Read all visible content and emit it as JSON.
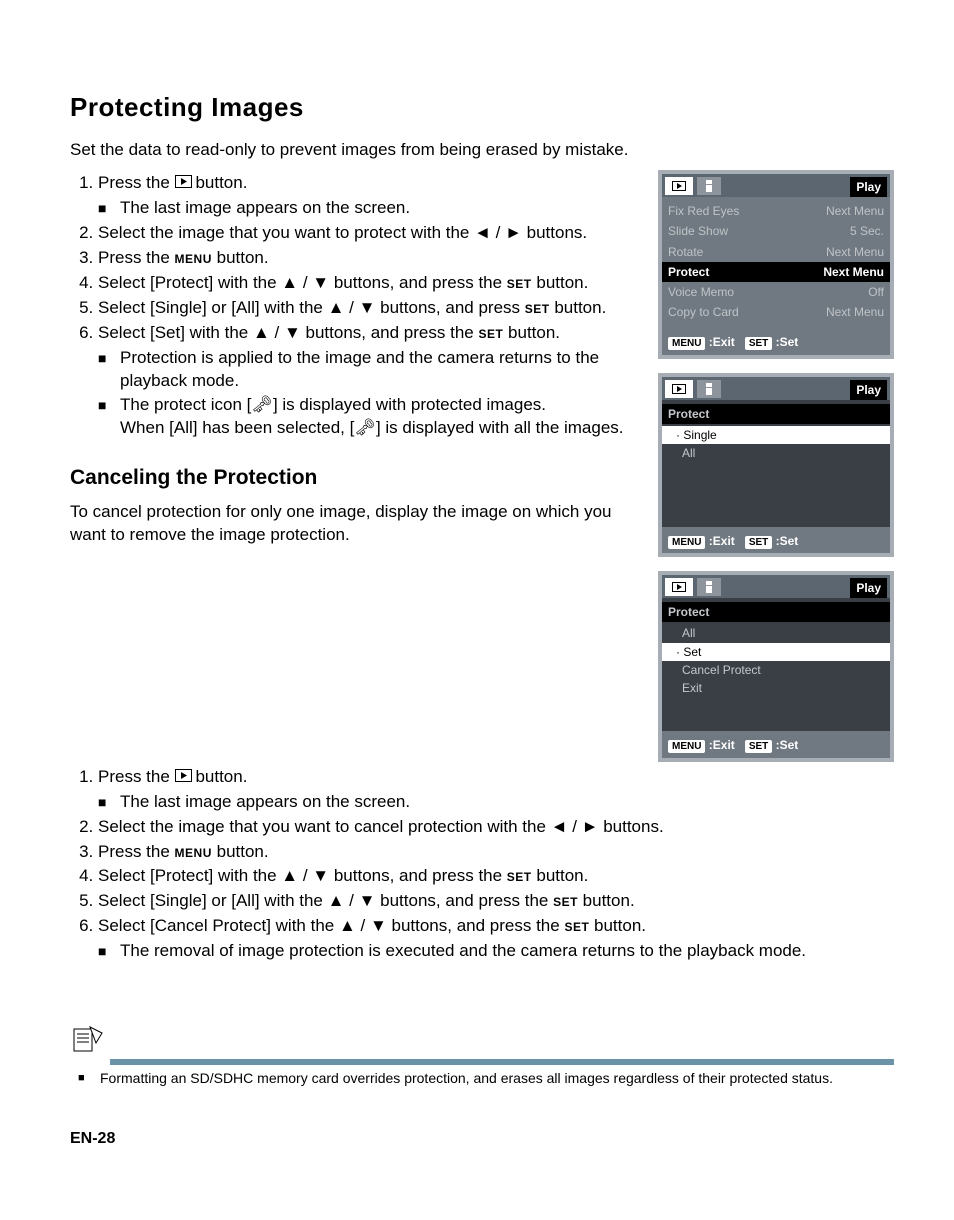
{
  "page_title": "Protecting Images",
  "intro": "Set the data to read-only to prevent images from being erased by mistake.",
  "steps_a": {
    "s1": "Press the ",
    "s1b": " button.",
    "s1_sub": "The last image appears on the screen.",
    "s2": "Select the image that you want to protect with the ◄ / ► buttons.",
    "s3": "Press the ",
    "s3b": " button.",
    "s4": "Select [Protect] with the ▲ / ▼ buttons, and press the ",
    "s4b": " button.",
    "s5": "Select [Single] or [All] with the ▲ / ▼ buttons, and press ",
    "s5b": " button.",
    "s6": "Select [Set] with the ▲ / ▼ buttons, and press the ",
    "s6b": " button.",
    "s6_sub1": "Protection is applied to the image and the camera returns to the playback mode.",
    "s6_sub2a": "The protect icon [",
    "s6_sub2b": "] is displayed with protected images.",
    "s6_sub3a": "When [All] has been selected, [",
    "s6_sub3b": "] is displayed with all the images."
  },
  "cancel_title": "Canceling the Protection",
  "cancel_intro": "To cancel protection for only one image, display the image on which you want to remove the image protection.",
  "steps_b": {
    "s1": "Press the ",
    "s1b": " button.",
    "s1_sub": "The last image appears on the screen.",
    "s2": "Select the image that you want to cancel protection with the ◄ / ► buttons.",
    "s3": "Press the ",
    "s3b": " button.",
    "s4": "Select [Protect] with the ▲ / ▼ buttons, and press the ",
    "s4b": " button.",
    "s5": "Select [Single] or [All] with the ▲ / ▼ buttons, and press the ",
    "s5b": " button.",
    "s6": "Select [Cancel Protect] with the ▲ / ▼ buttons, and press the ",
    "s6b": " button.",
    "s6_sub": "The removal of image protection is executed and the camera returns to the playback mode."
  },
  "labels": {
    "menu": "MENU",
    "set": "SET",
    "play_glyph": "▸"
  },
  "fig1": {
    "title": "Play",
    "rows": [
      [
        "Fix Red Eyes",
        "Next Menu"
      ],
      [
        "Slide Show",
        "5 Sec."
      ],
      [
        "Rotate",
        "Next Menu"
      ],
      [
        "Protect",
        "Next Menu"
      ],
      [
        "Voice Memo",
        "Off"
      ],
      [
        "Copy to Card",
        "Next Menu"
      ]
    ],
    "footer_exit": ":Exit",
    "footer_set": ":Set"
  },
  "fig2": {
    "title": "Play",
    "header": "Protect",
    "rows": [
      "Single",
      "All"
    ],
    "footer_exit": ":Exit",
    "footer_set": ":Set"
  },
  "fig3": {
    "title": "Play",
    "header": "Protect",
    "top": "All",
    "rows": [
      "Set",
      "Cancel Protect",
      "Exit"
    ],
    "footer_exit": ":Exit",
    "footer_set": ":Set"
  },
  "note": "Formatting an SD/SDHC memory card overrides protection, and erases all images regardless of their protected status.",
  "page_no": "EN-28"
}
